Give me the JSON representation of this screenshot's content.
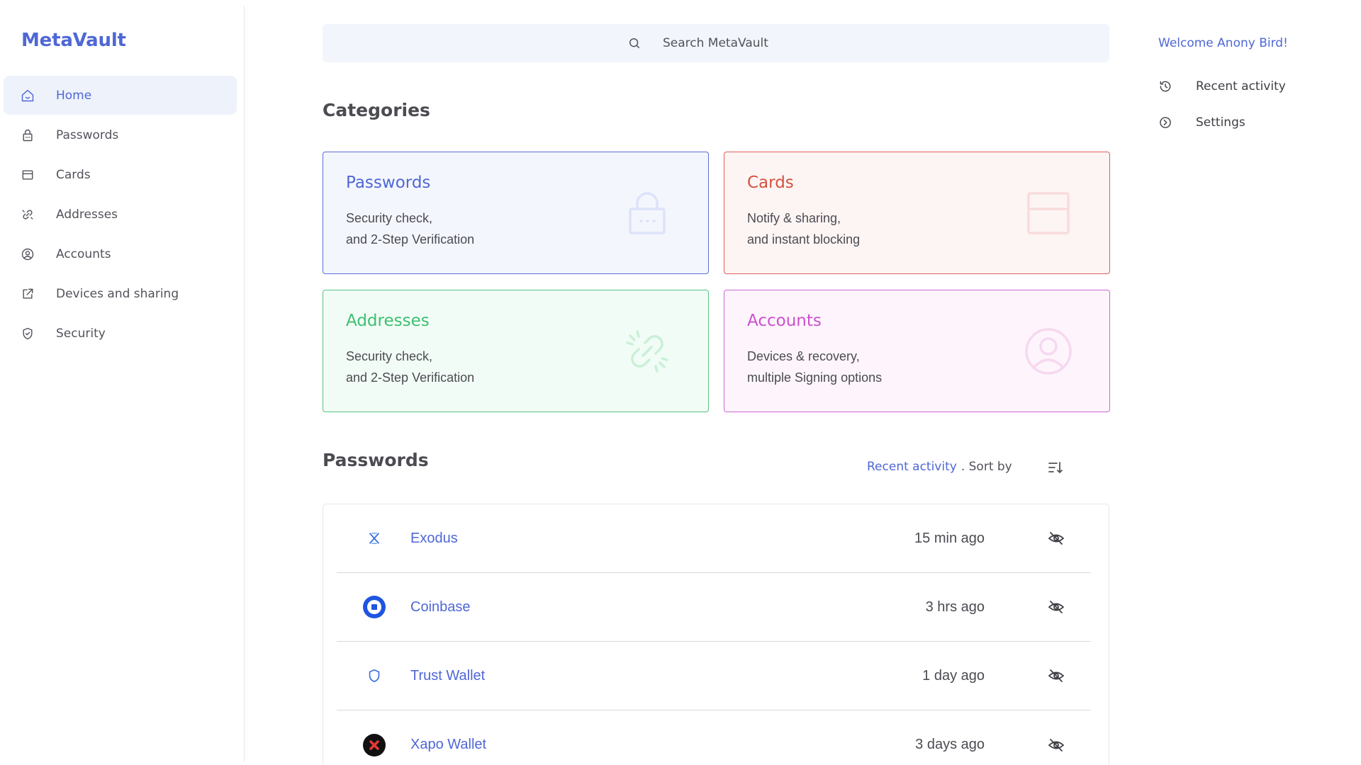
{
  "app": {
    "title": "MetaVault"
  },
  "sidebar": {
    "items": [
      {
        "label": "Home",
        "icon": "home-icon",
        "active": true
      },
      {
        "label": "Passwords",
        "icon": "lock-icon"
      },
      {
        "label": "Cards",
        "icon": "card-icon"
      },
      {
        "label": "Addresses",
        "icon": "link-icon"
      },
      {
        "label": "Accounts",
        "icon": "user-circle-icon"
      },
      {
        "label": "Devices and sharing",
        "icon": "external-link-icon"
      },
      {
        "label": "Security",
        "icon": "shield-icon"
      }
    ]
  },
  "search": {
    "placeholder": "Search MetaVault"
  },
  "categories": {
    "title": "Categories",
    "cards": [
      {
        "title": "Passwords",
        "line1": "Security check,",
        "line2": "and 2-Step Verification",
        "icon": "lock-icon",
        "color": "#4f67d6"
      },
      {
        "title": "Cards",
        "line1": "Notify & sharing,",
        "line2": "and instant blocking",
        "icon": "card-icon",
        "color": "#d5503f"
      },
      {
        "title": "Addresses",
        "line1": "Security check,",
        "line2": "and 2-Step Verification",
        "icon": "broken-link-icon",
        "color": "#3ec071"
      },
      {
        "title": "Accounts",
        "line1": "Devices & recovery,",
        "line2": "multiple Signing options",
        "icon": "user-circle-icon",
        "color": "#cc4fd0"
      }
    ]
  },
  "passwords": {
    "title": "Passwords",
    "sort_link": "Recent activity",
    "sort_text": ". Sort by",
    "rows": [
      {
        "name": "Exodus",
        "time": "15 min ago",
        "logo": "exodus-logo"
      },
      {
        "name": "Coinbase",
        "time": "3 hrs ago",
        "logo": "coinbase-logo"
      },
      {
        "name": "Trust Wallet",
        "time": "1 day ago",
        "logo": "trust-wallet-logo"
      },
      {
        "name": "Xapo Wallet",
        "time": "3 days ago",
        "logo": "xapo-wallet-logo"
      }
    ]
  },
  "right_panel": {
    "welcome": "Welcome Anony Bird!",
    "items": [
      {
        "label": "Recent activity",
        "icon": "history-icon"
      },
      {
        "label": "Settings",
        "icon": "settings-icon"
      }
    ]
  }
}
